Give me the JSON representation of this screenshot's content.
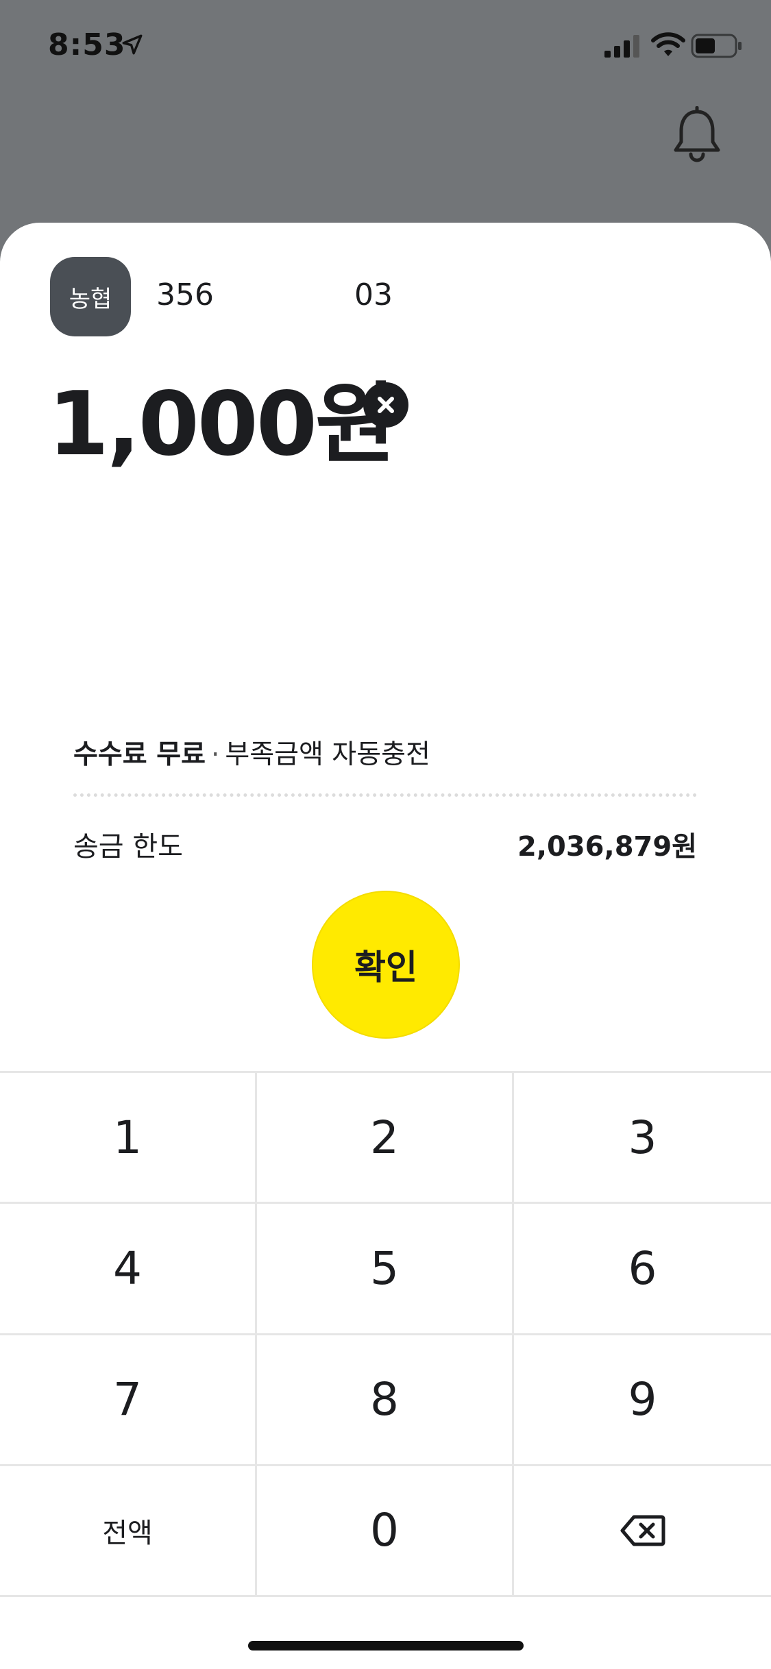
{
  "status_bar": {
    "time": "8:53"
  },
  "header": {
    "bell_icon": "bell-icon"
  },
  "account": {
    "bank_name": "농협",
    "number_part1": "356",
    "number_part2": "03"
  },
  "amount": {
    "value": "1,000원"
  },
  "info": {
    "fee_label": "수수료 무료",
    "separator": "·",
    "auto_charge": "부족금액 자동충전",
    "limit_label": "송금 한도",
    "limit_value": "2,036,879원"
  },
  "confirm": {
    "label": "확인",
    "color": "#ffea00"
  },
  "keypad": {
    "keys": [
      "1",
      "2",
      "3",
      "4",
      "5",
      "6",
      "7",
      "8",
      "9",
      "전액",
      "0"
    ],
    "backspace_icon": "backspace-icon"
  }
}
